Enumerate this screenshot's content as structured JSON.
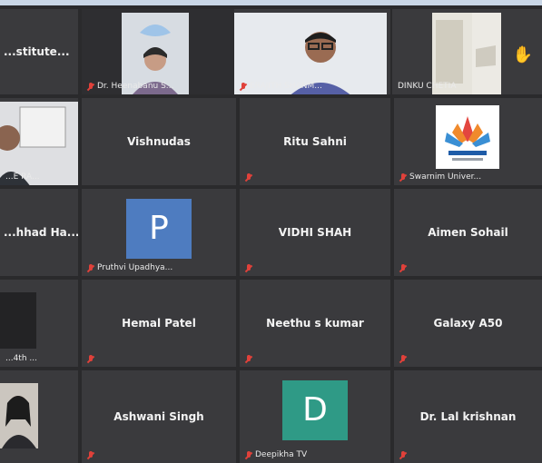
{
  "participants": [
    {
      "name": "...stitute...",
      "kind": "name"
    },
    {
      "name": "Dr. Heenabanu S...",
      "kind": "video"
    },
    {
      "name": "ERAJITH SHANM...",
      "kind": "video"
    },
    {
      "name": "DINKU CHETIA",
      "kind": "video"
    },
    {
      "name": "...E RA...",
      "kind": "video"
    },
    {
      "name": "Vishnudas",
      "kind": "name"
    },
    {
      "name": "Ritu Sahni",
      "kind": "name"
    },
    {
      "name": "Swarnim Univer...",
      "kind": "logo"
    },
    {
      "name": "...hhad Ha...",
      "kind": "name"
    },
    {
      "name": "Pruthvi Upadhya...",
      "kind": "avatar",
      "initial": "P",
      "color": "#4e7cc0"
    },
    {
      "name": "VIDHI SHAH",
      "kind": "name"
    },
    {
      "name": "Aimen Sohail",
      "kind": "name"
    },
    {
      "name": "...4th ...",
      "kind": "video"
    },
    {
      "name": "Hemal Patel",
      "kind": "name"
    },
    {
      "name": "Neethu s kumar",
      "kind": "name"
    },
    {
      "name": "Galaxy A50",
      "kind": "name"
    },
    {
      "name": "",
      "kind": "video"
    },
    {
      "name": "Ashwani Singh",
      "kind": "name"
    },
    {
      "name": "Deepikha TV",
      "kind": "avatar",
      "initial": "D",
      "color": "#2f9a86"
    },
    {
      "name": "Dr. Lal krishnan",
      "kind": "name"
    }
  ],
  "raised_hand_icon": "raise-hand-icon",
  "muted_icon": "muted-mic-icon",
  "colors": {
    "tile_bg": "#3a3a3d",
    "mute_red": "#e0413a",
    "avatar_blue": "#4e7cc0",
    "avatar_teal": "#2f9a86"
  }
}
